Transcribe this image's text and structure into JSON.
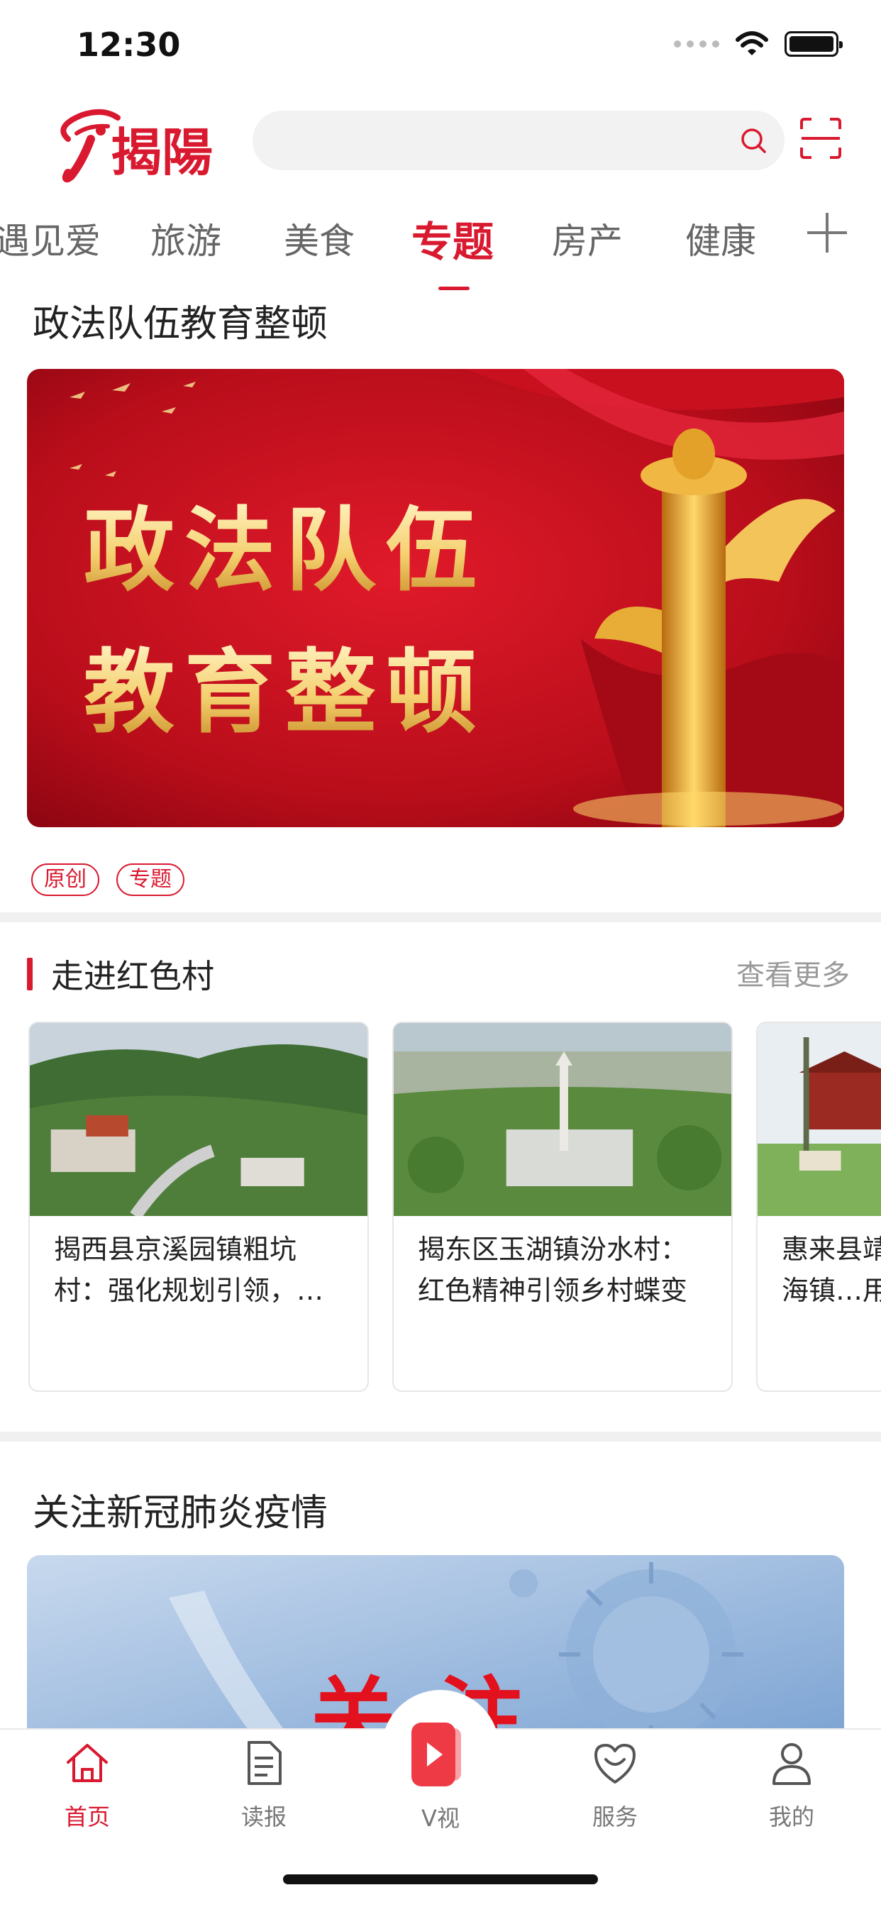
{
  "status_bar": {
    "time": "12:30"
  },
  "header": {
    "logo_text": "揭陽",
    "search_placeholder": ""
  },
  "channels": [
    {
      "label": "遇见爱",
      "active": false
    },
    {
      "label": "旅游",
      "active": false
    },
    {
      "label": "美食",
      "active": false
    },
    {
      "label": "专题",
      "active": true
    },
    {
      "label": "房产",
      "active": false
    },
    {
      "label": "健康",
      "active": false
    }
  ],
  "feature": {
    "title": "政法队伍教育整顿",
    "banner_line1": "政法队伍",
    "banner_line2": "教育整顿",
    "tags": [
      "原创",
      "专题"
    ]
  },
  "red_village": {
    "title": "走进红色村",
    "more_label": "查看更多",
    "cards": [
      {
        "text": "揭西县京溪园镇粗坑村：强化规划引领，…"
      },
      {
        "text": "揭东区玉湖镇汾水村：红色精神引领乡村蝶变"
      },
      {
        "text": "惠来县靖海镇…用足“海”…"
      }
    ]
  },
  "covid": {
    "title": "关注新冠肺炎疫情",
    "banner_text": "关注"
  },
  "bottom_nav": [
    {
      "label": "首页",
      "icon": "home-icon",
      "active": true
    },
    {
      "label": "读报",
      "icon": "newspaper-icon",
      "active": false
    },
    {
      "label": "V视",
      "icon": "video-play-icon",
      "active": false
    },
    {
      "label": "服务",
      "icon": "service-heart-icon",
      "active": false
    },
    {
      "label": "我的",
      "icon": "profile-icon",
      "active": false
    }
  ],
  "colors": {
    "accent": "#d9192f",
    "gold": "#f6d27a"
  }
}
